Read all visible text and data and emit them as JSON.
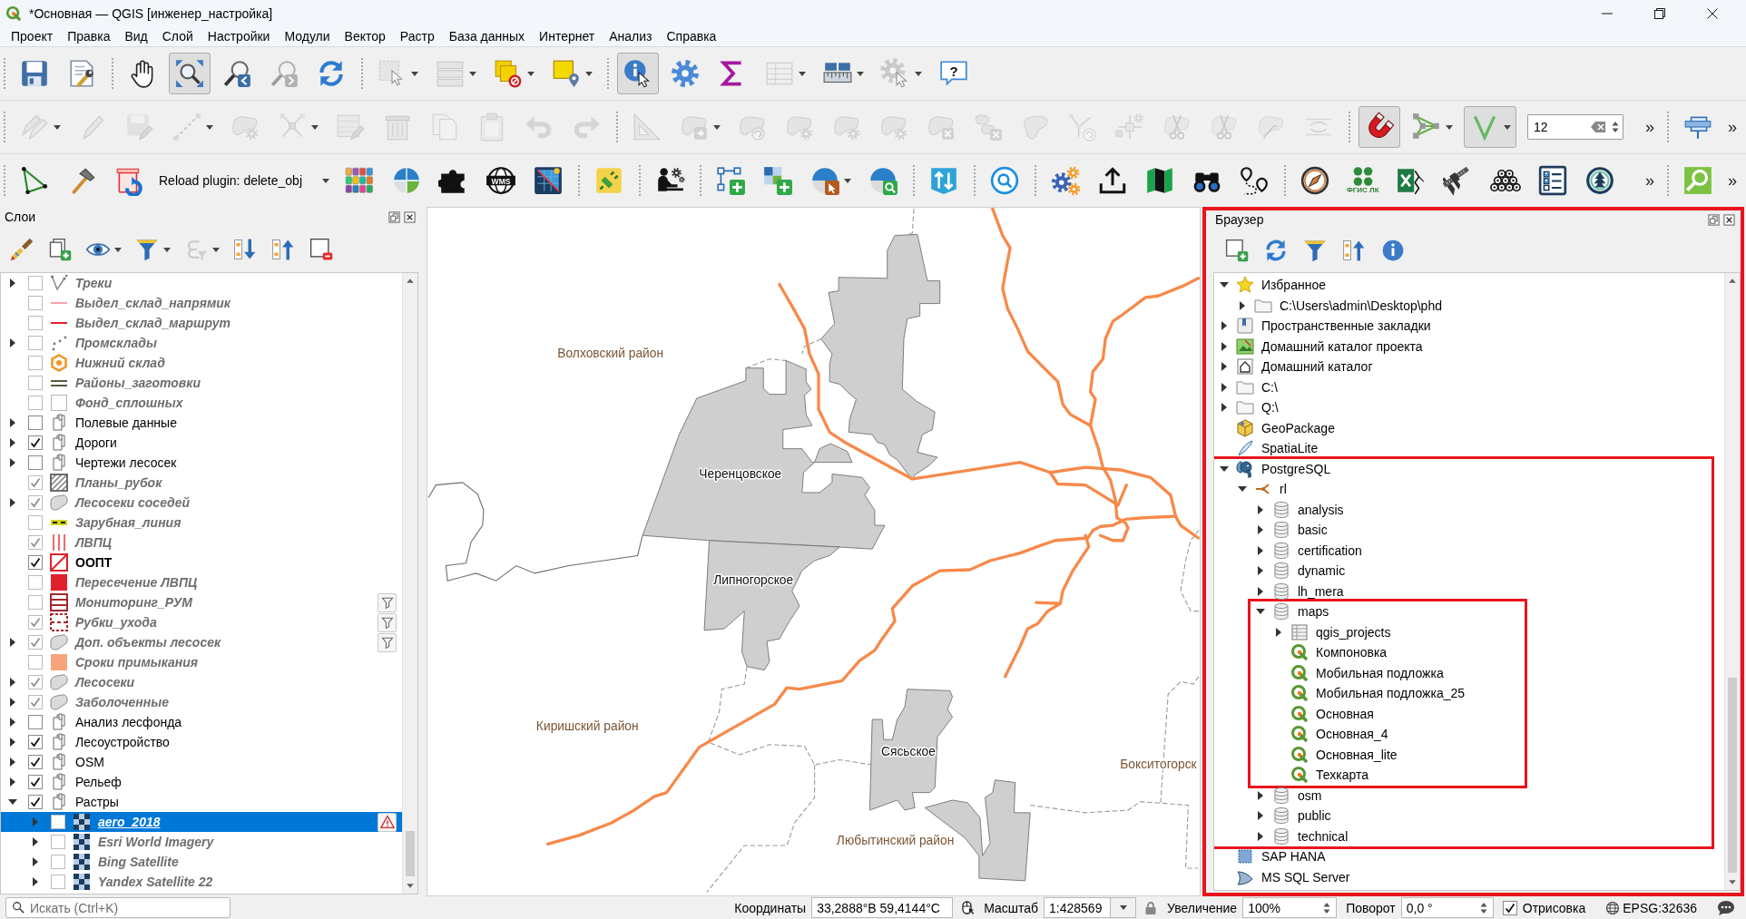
{
  "window": {
    "title": "*Основная — QGIS [инженер_настройка]"
  },
  "menu": [
    "Проект",
    "Правка",
    "Вид",
    "Слой",
    "Настройки",
    "Модули",
    "Вектор",
    "Растр",
    "База данных",
    "Интернет",
    "Анализ",
    "Справка"
  ],
  "toolbar_rows": [
    {
      "groups": [
        {
          "items": [
            {
              "kind": "button",
              "disabled": false,
              "pressed": false,
              "menu": false
            },
            {
              "kind": "button",
              "disabled": false,
              "pressed": false,
              "menu": false
            }
          ]
        },
        {
          "items": [
            {
              "kind": "button",
              "disabled": false,
              "pressed": false,
              "menu": false
            },
            {
              "kind": "button",
              "disabled": false,
              "pressed": true,
              "menu": false
            },
            {
              "kind": "button",
              "disabled": false,
              "pressed": false,
              "menu": false
            },
            {
              "kind": "button",
              "disabled": true,
              "pressed": false,
              "menu": false
            },
            {
              "kind": "button",
              "disabled": false,
              "pressed": false,
              "menu": false
            }
          ]
        },
        {
          "items": [
            {
              "kind": "button",
              "disabled": true,
              "pressed": false,
              "menu": true
            },
            {
              "kind": "button",
              "disabled": true,
              "pressed": false,
              "menu": true
            },
            {
              "kind": "button",
              "disabled": false,
              "pressed": false,
              "menu": true
            },
            {
              "kind": "button",
              "disabled": false,
              "pressed": false,
              "menu": true
            }
          ]
        },
        {
          "items": [
            {
              "kind": "button",
              "disabled": false,
              "pressed": true,
              "menu": false
            },
            {
              "kind": "button",
              "disabled": false,
              "pressed": false,
              "menu": false
            },
            {
              "kind": "button",
              "disabled": false,
              "pressed": false,
              "menu": false
            },
            {
              "kind": "button",
              "disabled": true,
              "pressed": false,
              "menu": true
            },
            {
              "kind": "button",
              "disabled": false,
              "pressed": false,
              "menu": true
            },
            {
              "kind": "button",
              "disabled": true,
              "pressed": false,
              "menu": true
            },
            {
              "kind": "button",
              "disabled": false,
              "pressed": false,
              "menu": false,
              "label": "?"
            }
          ]
        }
      ]
    },
    {
      "groups": [
        {
          "items": [
            {
              "kind": "button",
              "disabled": true,
              "pressed": false,
              "menu": true
            },
            {
              "kind": "button",
              "disabled": true,
              "pressed": false,
              "menu": false
            },
            {
              "kind": "button",
              "disabled": true,
              "pressed": false,
              "menu": false
            },
            {
              "kind": "button",
              "disabled": true,
              "pressed": false,
              "menu": true
            },
            {
              "kind": "button",
              "disabled": true,
              "pressed": false,
              "menu": false
            },
            {
              "kind": "button",
              "disabled": true,
              "pressed": false,
              "menu": true
            },
            {
              "kind": "button",
              "disabled": true,
              "pressed": false,
              "menu": false
            },
            {
              "kind": "button",
              "disabled": true,
              "pressed": false,
              "menu": false
            },
            {
              "kind": "button",
              "disabled": true,
              "pressed": false,
              "menu": false
            },
            {
              "kind": "button",
              "disabled": true,
              "pressed": false,
              "menu": false
            },
            {
              "kind": "button",
              "disabled": true,
              "pressed": false,
              "menu": false
            },
            {
              "kind": "button",
              "disabled": true,
              "pressed": false,
              "menu": false
            }
          ]
        },
        {
          "items": [
            {
              "kind": "button",
              "disabled": true,
              "pressed": false,
              "menu": false
            },
            {
              "kind": "button",
              "disabled": true,
              "pressed": false,
              "menu": true
            },
            {
              "kind": "button",
              "disabled": true,
              "pressed": false,
              "menu": false
            },
            {
              "kind": "button",
              "disabled": true,
              "pressed": false,
              "menu": false
            },
            {
              "kind": "button",
              "disabled": true,
              "pressed": false,
              "menu": false
            },
            {
              "kind": "button",
              "disabled": true,
              "pressed": false,
              "menu": false
            },
            {
              "kind": "button",
              "disabled": true,
              "pressed": false,
              "menu": false
            },
            {
              "kind": "button",
              "disabled": true,
              "pressed": false,
              "menu": false
            },
            {
              "kind": "button",
              "disabled": true,
              "pressed": false,
              "menu": false
            },
            {
              "kind": "button",
              "disabled": true,
              "pressed": false,
              "menu": false
            },
            {
              "kind": "button",
              "disabled": true,
              "pressed": false,
              "menu": false
            },
            {
              "kind": "button",
              "disabled": true,
              "pressed": false,
              "menu": false
            },
            {
              "kind": "button",
              "disabled": true,
              "pressed": false,
              "menu": false
            },
            {
              "kind": "button",
              "disabled": true,
              "pressed": false,
              "menu": false
            },
            {
              "kind": "button",
              "disabled": true,
              "pressed": false,
              "menu": false
            }
          ]
        },
        {
          "items": [
            {
              "kind": "button",
              "disabled": false,
              "pressed": true,
              "menu": false
            },
            {
              "kind": "button",
              "disabled": false,
              "pressed": false,
              "menu": true
            },
            {
              "kind": "button",
              "disabled": false,
              "pressed": true,
              "menu": true
            },
            {
              "kind": "spin",
              "value": "12"
            },
            {
              "kind": "overflow",
              "label": "»"
            }
          ]
        },
        {
          "items": [
            {
              "kind": "button",
              "disabled": false,
              "pressed": false,
              "menu": false
            },
            {
              "kind": "overflow",
              "label": "»"
            }
          ]
        }
      ]
    },
    {
      "groups": [
        {
          "items": [
            {
              "kind": "button",
              "disabled": false,
              "pressed": false,
              "menu": false
            },
            {
              "kind": "button",
              "disabled": false,
              "pressed": false,
              "menu": false
            },
            {
              "kind": "button",
              "disabled": false,
              "pressed": false,
              "menu": false
            },
            {
              "kind": "combo",
              "value": "Reload plugin: delete_obj"
            },
            {
              "kind": "button",
              "disabled": false,
              "pressed": false,
              "menu": false
            },
            {
              "kind": "button",
              "disabled": false,
              "pressed": false,
              "menu": false
            },
            {
              "kind": "button",
              "disabled": false,
              "pressed": false,
              "menu": false
            },
            {
              "kind": "button",
              "disabled": false,
              "pressed": false,
              "menu": false,
              "label": "WMS"
            },
            {
              "kind": "button",
              "disabled": false,
              "pressed": false,
              "menu": false
            }
          ]
        },
        {
          "items": [
            {
              "kind": "button",
              "disabled": false,
              "pressed": false,
              "menu": false
            }
          ]
        },
        {
          "items": [
            {
              "kind": "button",
              "disabled": false,
              "pressed": false,
              "menu": false
            }
          ]
        },
        {
          "items": [
            {
              "kind": "button",
              "disabled": false,
              "pressed": false,
              "menu": false
            },
            {
              "kind": "button",
              "disabled": false,
              "pressed": false,
              "menu": false
            },
            {
              "kind": "button",
              "disabled": false,
              "pressed": false,
              "menu": true
            },
            {
              "kind": "button",
              "disabled": false,
              "pressed": false,
              "menu": false
            }
          ]
        },
        {
          "items": [
            {
              "kind": "button",
              "disabled": false,
              "pressed": false,
              "menu": false
            }
          ]
        },
        {
          "items": [
            {
              "kind": "button",
              "disabled": false,
              "pressed": false,
              "menu": false
            }
          ]
        },
        {
          "items": [
            {
              "kind": "button",
              "disabled": false,
              "pressed": false,
              "menu": false
            },
            {
              "kind": "button",
              "disabled": false,
              "pressed": false,
              "menu": false
            },
            {
              "kind": "button",
              "disabled": false,
              "pressed": false,
              "menu": false
            },
            {
              "kind": "button",
              "disabled": false,
              "pressed": false,
              "menu": false
            },
            {
              "kind": "button",
              "disabled": false,
              "pressed": false,
              "menu": false
            }
          ]
        },
        {
          "items": [
            {
              "kind": "button",
              "disabled": false,
              "pressed": false,
              "menu": false
            },
            {
              "kind": "button",
              "disabled": false,
              "pressed": false,
              "menu": false,
              "label": "ФГИС ЛК"
            },
            {
              "kind": "button",
              "disabled": false,
              "pressed": false,
              "menu": false
            },
            {
              "kind": "button",
              "disabled": false,
              "pressed": false,
              "menu": false
            },
            {
              "kind": "button",
              "disabled": false,
              "pressed": false,
              "menu": false
            },
            {
              "kind": "button",
              "disabled": false,
              "pressed": false,
              "menu": false
            },
            {
              "kind": "button",
              "disabled": false,
              "pressed": false,
              "menu": false
            },
            {
              "kind": "overflow",
              "label": "»"
            }
          ]
        },
        {
          "items": [
            {
              "kind": "button",
              "disabled": false,
              "pressed": false,
              "menu": false
            },
            {
              "kind": "overflow",
              "label": "»"
            }
          ]
        }
      ]
    }
  ],
  "layers": {
    "title": "Слои",
    "toolbar": [
      {
        "disabled": false,
        "menu": false
      },
      {
        "disabled": false,
        "menu": false
      },
      {
        "disabled": false,
        "menu": true
      },
      {
        "disabled": false,
        "menu": true
      },
      {
        "disabled": true,
        "menu": true
      },
      {
        "disabled": false,
        "menu": false
      },
      {
        "disabled": false,
        "menu": false
      },
      {
        "disabled": false,
        "menu": false
      }
    ],
    "tree": [
      {
        "label": "Треки",
        "kind": "track",
        "expandable": true,
        "expanded": false,
        "checked": false,
        "greyed": true,
        "bold": true,
        "filtered": false,
        "warning": false,
        "selected": false
      },
      {
        "label": "Выдел_склад_напрямик",
        "kind": "line",
        "color": "#f4a3ab",
        "expandable": false,
        "checked": false,
        "greyed": true,
        "bold": true,
        "filtered": false,
        "warning": false,
        "selected": false
      },
      {
        "label": "Выдел_склад_маршрут",
        "kind": "line",
        "color": "#e0202a",
        "expandable": false,
        "checked": false,
        "greyed": true,
        "bold": true,
        "filtered": false,
        "warning": false,
        "selected": false
      },
      {
        "label": "Промсклады",
        "kind": "points",
        "expandable": true,
        "expanded": false,
        "checked": false,
        "greyed": true,
        "bold": true,
        "filtered": false,
        "warning": false,
        "selected": false
      },
      {
        "label": "Нижний склад",
        "kind": "hexagon",
        "color": "#f39423",
        "expandable": false,
        "checked": false,
        "greyed": true,
        "bold": true,
        "filtered": false,
        "warning": false,
        "selected": false
      },
      {
        "label": "Районы_заготовки",
        "kind": "double_line",
        "color": "#5b5a3c",
        "expandable": false,
        "checked": false,
        "greyed": true,
        "bold": true,
        "filtered": false,
        "warning": false,
        "selected": false
      },
      {
        "label": "Фонд_сплошных",
        "kind": "blank",
        "expandable": false,
        "checked": false,
        "greyed": true,
        "bold": true,
        "filtered": false,
        "warning": false,
        "selected": false
      },
      {
        "label": "Полевые данные",
        "kind": "group",
        "expandable": true,
        "expanded": false,
        "checked": false,
        "greyed": false,
        "bold": false,
        "filtered": false,
        "warning": false,
        "selected": false
      },
      {
        "label": "Дороги",
        "kind": "group",
        "expandable": true,
        "expanded": false,
        "checked": true,
        "greyed": false,
        "bold": false,
        "filtered": false,
        "warning": false,
        "selected": false
      },
      {
        "label": "Чертежи лесосек",
        "kind": "group",
        "expandable": true,
        "expanded": false,
        "checked": false,
        "greyed": false,
        "bold": false,
        "filtered": false,
        "warning": false,
        "selected": false
      },
      {
        "label": "Планы_рубок",
        "kind": "hatch",
        "color": "#6b6b6b",
        "expandable": false,
        "checked": true,
        "greyed": true,
        "bold": true,
        "filtered": false,
        "warning": false,
        "selected": false
      },
      {
        "label": "Лесосеки соседей",
        "kind": "blob",
        "expandable": true,
        "expanded": false,
        "checked": true,
        "greyed": true,
        "bold": true,
        "filtered": false,
        "warning": false,
        "selected": false
      },
      {
        "label": "Зарубная_линия",
        "kind": "dash_line",
        "color": "#d4d422",
        "expandable": false,
        "checked": false,
        "greyed": true,
        "bold": true,
        "filtered": false,
        "warning": false,
        "selected": false
      },
      {
        "label": "ЛВПЦ",
        "kind": "vlines",
        "color": "#ee6b6b",
        "expandable": false,
        "checked": true,
        "greyed": true,
        "bold": true,
        "filtered": false,
        "warning": false,
        "selected": false
      },
      {
        "label": "ООПТ",
        "kind": "slash",
        "color": "#e0202a",
        "expandable": false,
        "checked": true,
        "greyed": false,
        "bold": true,
        "filtered": false,
        "warning": false,
        "selected": false
      },
      {
        "label": "Пересечение ЛВПЦ",
        "kind": "fill",
        "color": "#e0202a",
        "expandable": false,
        "checked": false,
        "greyed": true,
        "bold": true,
        "filtered": false,
        "warning": false,
        "selected": false
      },
      {
        "label": "Мониторинг_РУМ",
        "kind": "hlines",
        "color": "#a3282e",
        "expandable": false,
        "checked": false,
        "greyed": true,
        "bold": true,
        "filtered": true,
        "warning": false,
        "selected": false
      },
      {
        "label": "Рубки_ухода",
        "kind": "dashed_box",
        "color": "#a3282e",
        "expandable": false,
        "checked": true,
        "greyed": true,
        "bold": true,
        "filtered": true,
        "warning": false,
        "selected": false
      },
      {
        "label": "Доп. объекты лесосек",
        "kind": "blob",
        "expandable": true,
        "expanded": false,
        "checked": true,
        "greyed": true,
        "bold": true,
        "filtered": true,
        "warning": false,
        "selected": false
      },
      {
        "label": "Сроки примыкания",
        "kind": "fill",
        "color": "#f7a47b",
        "expandable": false,
        "checked": false,
        "greyed": true,
        "bold": true,
        "filtered": false,
        "warning": false,
        "selected": false
      },
      {
        "label": "Лесосеки",
        "kind": "blob",
        "expandable": true,
        "expanded": false,
        "checked": true,
        "greyed": true,
        "bold": true,
        "filtered": false,
        "warning": false,
        "selected": false
      },
      {
        "label": "Заболоченные",
        "kind": "blob",
        "expandable": true,
        "expanded": false,
        "checked": true,
        "greyed": true,
        "bold": true,
        "filtered": false,
        "warning": false,
        "selected": false
      },
      {
        "label": "Анализ лесфонда",
        "kind": "group",
        "expandable": true,
        "expanded": false,
        "checked": false,
        "greyed": false,
        "bold": false,
        "filtered": false,
        "warning": false,
        "selected": false
      },
      {
        "label": "Лесоустройство",
        "kind": "group",
        "expandable": true,
        "expanded": false,
        "checked": true,
        "greyed": false,
        "bold": false,
        "filtered": false,
        "warning": false,
        "selected": false
      },
      {
        "label": "OSM",
        "kind": "group",
        "expandable": true,
        "expanded": false,
        "checked": true,
        "greyed": false,
        "bold": false,
        "filtered": false,
        "warning": false,
        "selected": false
      },
      {
        "label": "Рельеф",
        "kind": "group",
        "expandable": true,
        "expanded": false,
        "checked": true,
        "greyed": false,
        "bold": false,
        "filtered": false,
        "warning": false,
        "selected": false
      },
      {
        "label": "Растры",
        "kind": "group",
        "expandable": true,
        "expanded": true,
        "checked": true,
        "greyed": false,
        "bold": false,
        "filtered": false,
        "warning": false,
        "selected": false,
        "children": [
          {
            "label": "aero_2018",
            "kind": "raster",
            "expandable": true,
            "expanded": false,
            "checked": false,
            "greyed": true,
            "bold": true,
            "filtered": false,
            "warning": true,
            "selected": true
          },
          {
            "label": "Esri World Imagery",
            "kind": "raster",
            "expandable": true,
            "expanded": false,
            "checked": false,
            "greyed": true,
            "bold": true,
            "filtered": false,
            "warning": false,
            "selected": false
          },
          {
            "label": "Bing Satellite",
            "kind": "raster",
            "expandable": true,
            "expanded": false,
            "checked": false,
            "greyed": true,
            "bold": true,
            "filtered": false,
            "warning": false,
            "selected": false
          },
          {
            "label": "Yandex Satellite 22",
            "kind": "raster",
            "expandable": true,
            "expanded": false,
            "checked": false,
            "greyed": true,
            "bold": true,
            "filtered": false,
            "warning": false,
            "selected": false
          }
        ]
      }
    ]
  },
  "map": {
    "labels": [
      {
        "text": "Волховский район",
        "kind": "district"
      },
      {
        "text": "Черенцовское",
        "kind": "settlement"
      },
      {
        "text": "Липногорское",
        "kind": "settlement"
      },
      {
        "text": "Киришский район",
        "kind": "district"
      },
      {
        "text": "Сясьское",
        "kind": "settlement"
      },
      {
        "text": "Бокситогорск",
        "kind": "district"
      },
      {
        "text": "Любытинский район",
        "kind": "district"
      }
    ]
  },
  "browser": {
    "title": "Браузер",
    "highlighted": true,
    "tree": [
      {
        "label": "Избранное",
        "kind": "star",
        "expandable": true,
        "expanded": true,
        "highlighted": false,
        "children": [
          {
            "label": "C:\\Users\\admin\\Desktop\\phd",
            "kind": "folder",
            "expandable": true,
            "expanded": false,
            "highlighted": false
          }
        ]
      },
      {
        "label": "Пространственные закладки",
        "kind": "bookmarks",
        "expandable": true,
        "expanded": false,
        "highlighted": false
      },
      {
        "label": "Домашний каталог проекта",
        "kind": "project_home",
        "expandable": true,
        "expanded": false,
        "highlighted": false
      },
      {
        "label": "Домашний каталог",
        "kind": "home",
        "expandable": true,
        "expanded": false,
        "highlighted": false
      },
      {
        "label": "C:\\",
        "kind": "folder",
        "expandable": true,
        "expanded": false,
        "highlighted": false
      },
      {
        "label": "Q:\\",
        "kind": "folder",
        "expandable": true,
        "expanded": false,
        "highlighted": false
      },
      {
        "label": "GeoPackage",
        "kind": "geopackage",
        "expandable": false,
        "highlighted": false
      },
      {
        "label": "SpatiaLite",
        "kind": "spatialite",
        "expandable": false,
        "highlighted": false
      },
      {
        "label": "PostgreSQL",
        "kind": "postgres",
        "expandable": true,
        "expanded": true,
        "highlighted": true,
        "children": [
          {
            "label": "rl",
            "kind": "connection",
            "expandable": true,
            "expanded": true,
            "highlighted": false,
            "children": [
              {
                "label": "analysis",
                "kind": "schema",
                "expandable": true,
                "expanded": false,
                "highlighted": false
              },
              {
                "label": "basic",
                "kind": "schema",
                "expandable": true,
                "expanded": false,
                "highlighted": false
              },
              {
                "label": "certification",
                "kind": "schema",
                "expandable": true,
                "expanded": false,
                "highlighted": false
              },
              {
                "label": "dynamic",
                "kind": "schema",
                "expandable": true,
                "expanded": false,
                "highlighted": false
              },
              {
                "label": "lh_mera",
                "kind": "schema",
                "expandable": true,
                "expanded": false,
                "highlighted": false
              },
              {
                "label": "maps",
                "kind": "schema",
                "expandable": true,
                "expanded": true,
                "highlighted": true,
                "children": [
                  {
                    "label": "qgis_projects",
                    "kind": "table",
                    "expandable": true,
                    "expanded": false,
                    "highlighted": false
                  },
                  {
                    "label": "Компоновка",
                    "kind": "project",
                    "expandable": false,
                    "highlighted": false
                  },
                  {
                    "label": "Мобильная подложка",
                    "kind": "project",
                    "expandable": false,
                    "highlighted": false
                  },
                  {
                    "label": "Мобильная подложка_25",
                    "kind": "project",
                    "expandable": false,
                    "highlighted": false
                  },
                  {
                    "label": "Основная",
                    "kind": "project",
                    "expandable": false,
                    "highlighted": false
                  },
                  {
                    "label": "Основная_4",
                    "kind": "project",
                    "expandable": false,
                    "highlighted": false
                  },
                  {
                    "label": "Основная_lite",
                    "kind": "project",
                    "expandable": false,
                    "highlighted": false
                  },
                  {
                    "label": "Техкарта",
                    "kind": "project",
                    "expandable": false,
                    "highlighted": false
                  }
                ]
              },
              {
                "label": "osm",
                "kind": "schema",
                "expandable": true,
                "expanded": false,
                "highlighted": false
              },
              {
                "label": "public",
                "kind": "schema",
                "expandable": true,
                "expanded": false,
                "highlighted": false
              },
              {
                "label": "technical",
                "kind": "schema",
                "expandable": true,
                "expanded": false,
                "highlighted": false
              }
            ]
          }
        ]
      },
      {
        "label": "SAP HANA",
        "kind": "hana",
        "expandable": false,
        "highlighted": false
      },
      {
        "label": "MS SQL Server",
        "kind": "mssql",
        "expandable": false,
        "highlighted": false
      }
    ]
  },
  "status_bar": {
    "search": {
      "placeholder": "Искать (Ctrl+K)"
    },
    "coordinates": {
      "label": "Координаты",
      "value": "33,2888°В 59,4144°С"
    },
    "scale": {
      "label": "Масштаб",
      "value": "1:428569"
    },
    "magnifier": {
      "label": "Увеличение",
      "value": "100%"
    },
    "rotation": {
      "label": "Поворот",
      "value": "0,0 °"
    },
    "render": {
      "label": "Отрисовка",
      "checked": true
    },
    "crs": {
      "label": "EPSG:32636"
    }
  }
}
